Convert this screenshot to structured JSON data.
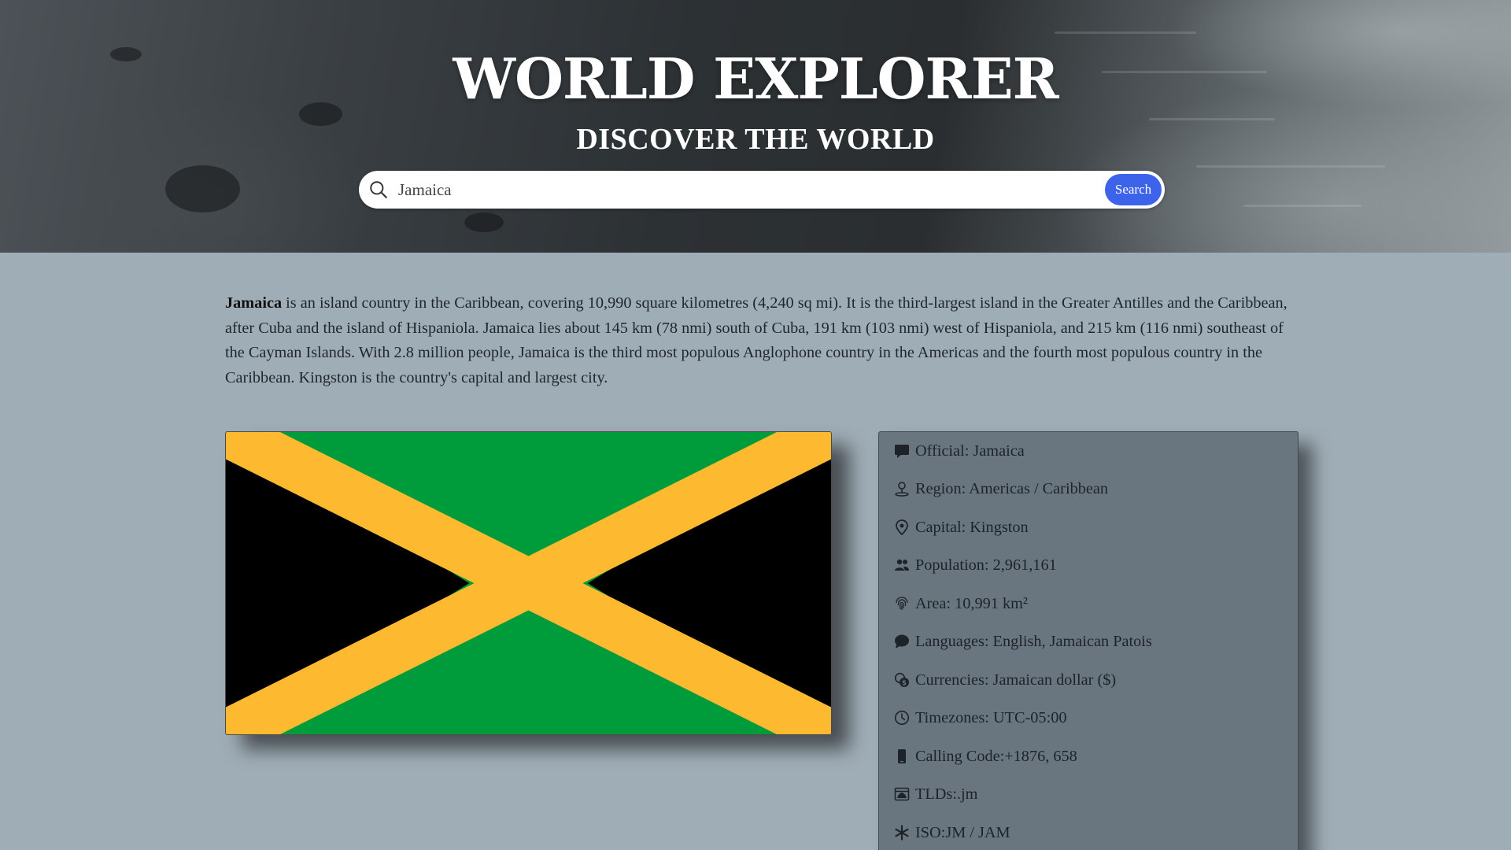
{
  "hero": {
    "title": "WORLD EXPLORER",
    "subtitle": "DISCOVER THE WORLD"
  },
  "search": {
    "value": "Jamaica",
    "button_label": "Search"
  },
  "description": {
    "country": "Jamaica",
    "text": " is an island country in the Caribbean, covering 10,990 square kilometres (4,240 sq mi). It is the third-largest island in the Greater Antilles and the Caribbean, after Cuba and the island of Hispaniola. Jamaica lies about 145 km (78 nmi) south of Cuba, 191 km (103 nmi) west of Hispaniola, and 215 km (116 nmi) southeast of the Cayman Islands. With 2.8 million people, Jamaica is the third most populous Anglophone country in the Americas and the fourth most populous country in the Caribbean. Kingston is the country's capital and largest city."
  },
  "flag": {
    "colors": {
      "green": "#009b3a",
      "gold": "#fdb930",
      "black": "#000000"
    }
  },
  "info": {
    "official": "Official: Jamaica",
    "region": "Region: Americas / Caribbean",
    "capital": "Capital: Kingston",
    "population": "Population: 2,961,161",
    "area": "Area: 10,991 km²",
    "languages": "Languages: English, Jamaican Patois",
    "currencies": "Currencies: Jamaican dollar ($)",
    "timezones": "Timezones: UTC-05:00",
    "calling_code": "Calling Code:+1876, 658",
    "tlds": "TLDs:.jm",
    "iso": "ISO:JM / JAM"
  },
  "theme": {
    "accent": "#3d63ea",
    "page_bg": "#9fadb6",
    "panel_bg": "#69767f"
  }
}
